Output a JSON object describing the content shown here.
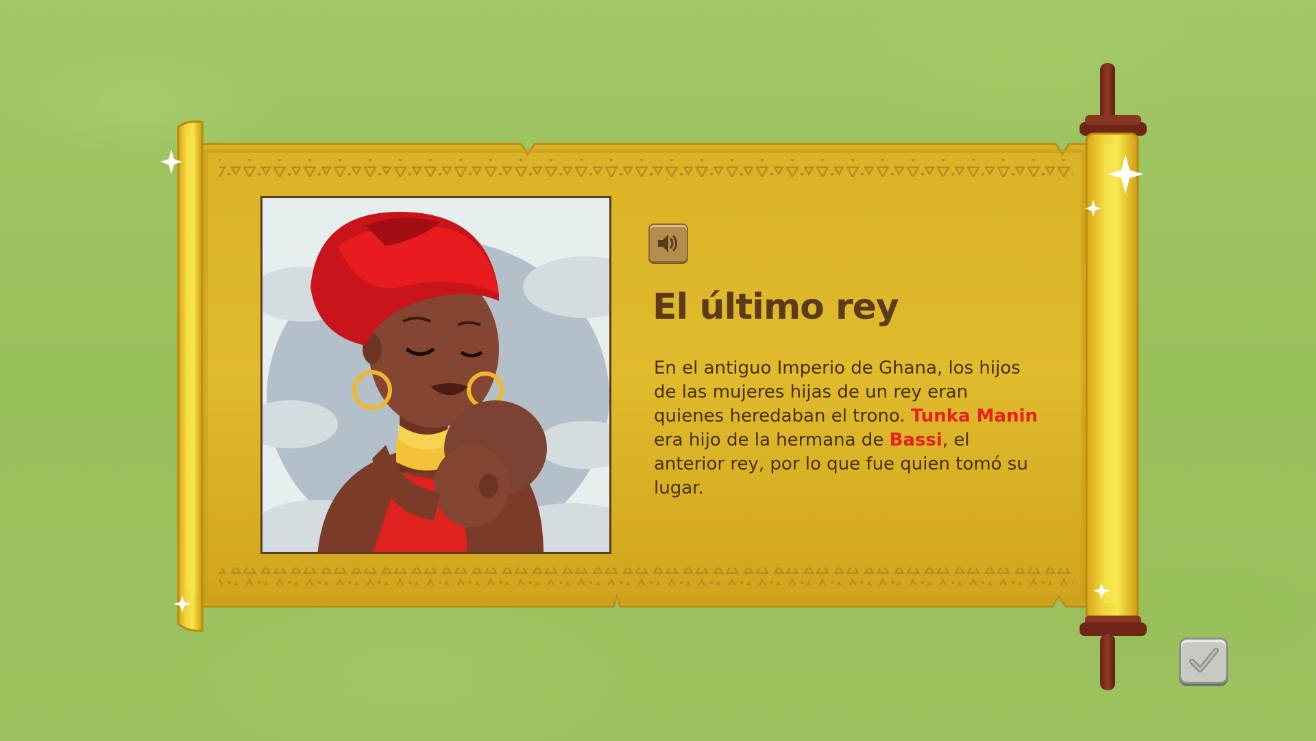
{
  "lesson": {
    "title": "El último rey",
    "paragraph": [
      {
        "text": "En el antiguo Imperio de Ghana, los hijos de las mujeres hijas de un rey eran quienes heredaban el trono. ",
        "highlight": false
      },
      {
        "text": "Tunka Manin",
        "highlight": true
      },
      {
        "text": " era hijo de la hermana de ",
        "highlight": false
      },
      {
        "text": "Bassi",
        "highlight": true
      },
      {
        "text": ", el anterior rey, por lo que fue quien tomó su lugar.",
        "highlight": false
      }
    ]
  },
  "controls": {
    "sound_icon": "speaker-icon",
    "confirm_icon": "checkmark-icon"
  },
  "illustration": {
    "subject": "mother-and-baby",
    "icon": "portrait-illustration"
  },
  "colors": {
    "background": "#9cc25e",
    "scroll_gold": "#d6ad1f",
    "highlight": "#e8201e",
    "title_brown": "#5c3a1c"
  }
}
